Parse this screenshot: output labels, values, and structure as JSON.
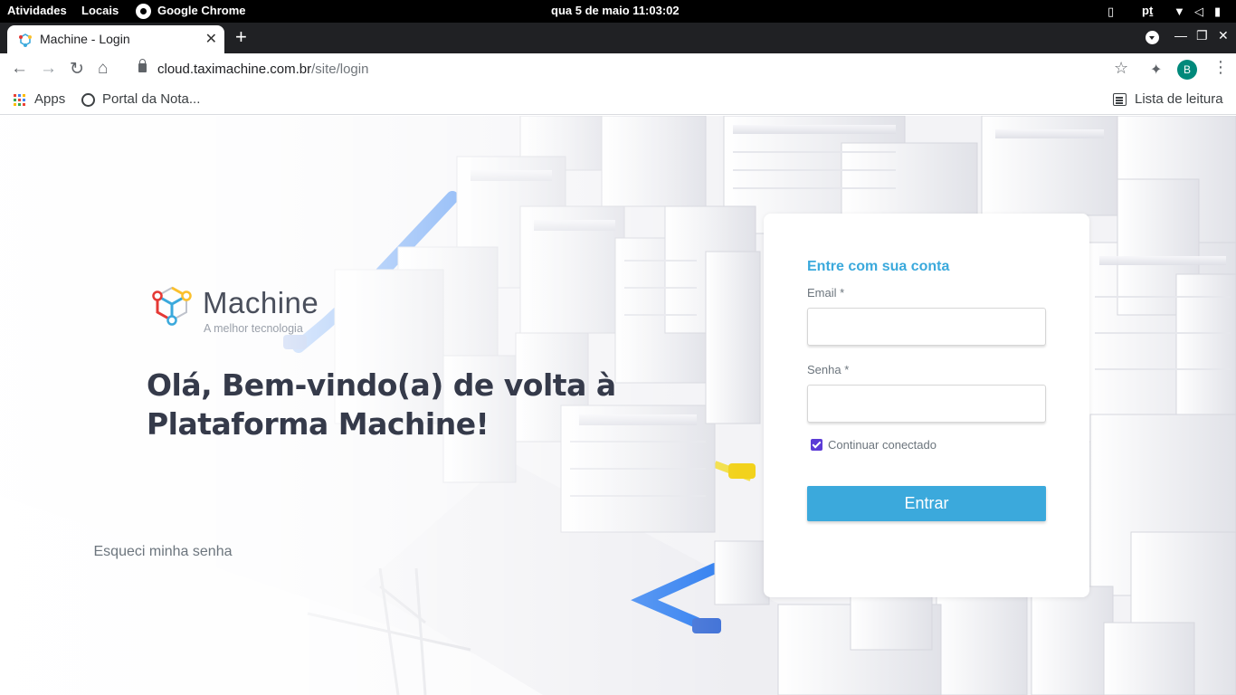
{
  "gnome": {
    "activities": "Atividades",
    "places": "Locais",
    "app_name": "Google Chrome",
    "datetime": "qua 5 de maio  11:03:02",
    "language": "pṯ"
  },
  "browser": {
    "tab_title": "Machine - Login",
    "url_domain": "cloud.taximachine.com.br",
    "url_path": "/site/login",
    "profile_initial": "B",
    "bookmarks": {
      "apps": "Apps",
      "portal": "Portal da Nota...",
      "reading_list": "Lista de leitura"
    }
  },
  "brand": {
    "name": "Machine",
    "tagline": "A melhor tecnologia"
  },
  "welcome_heading": "Olá, Bem-vindo(a) de volta à Plataforma Machine!",
  "login": {
    "title": "Entre com sua conta",
    "email_label": "Email *",
    "email_value": "",
    "password_label": "Senha *",
    "password_value": "",
    "remember_label": "Continuar conectado",
    "remember_checked": true,
    "submit_label": "Entrar",
    "forgot_label": "Esqueci minha senha"
  },
  "colors": {
    "accent": "#3ba9dc",
    "heading": "#353a4a",
    "checkbox": "#5b3bd6"
  }
}
